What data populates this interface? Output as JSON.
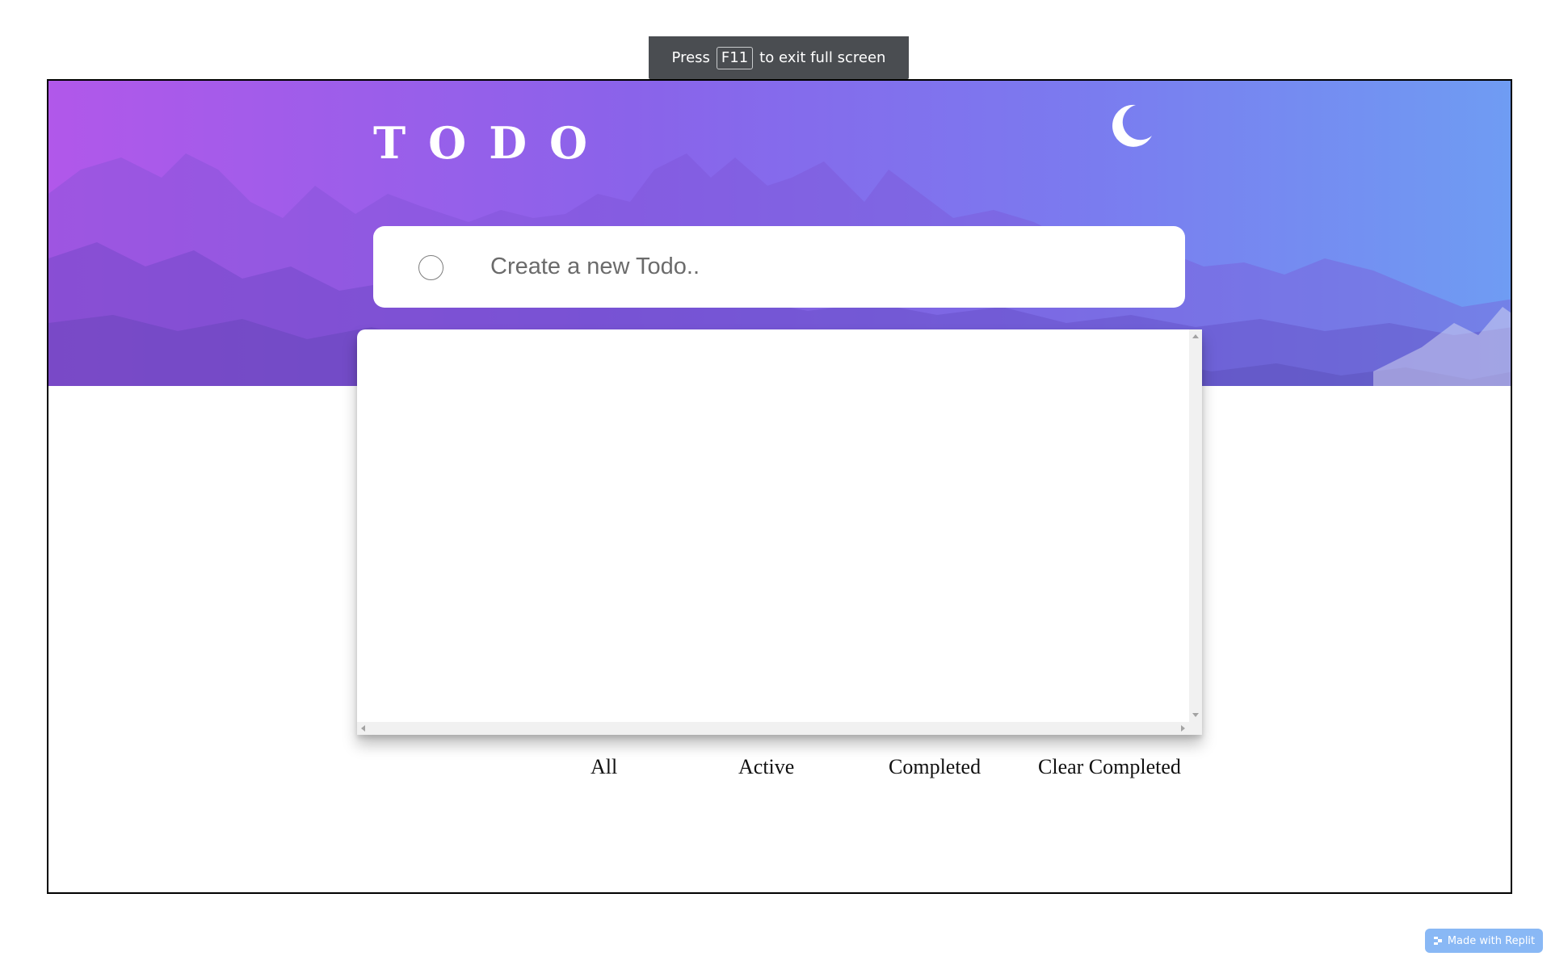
{
  "fullscreen_notice": {
    "prefix": "Press",
    "key": "F11",
    "suffix": "to exit full screen"
  },
  "header": {
    "title": "TODO",
    "theme_toggle_icon": "moon-icon"
  },
  "new_todo": {
    "placeholder": "Create a new Todo..",
    "value": ""
  },
  "todo_list": {
    "items": []
  },
  "filters": {
    "all": "All",
    "active": "Active",
    "completed": "Completed",
    "clear_completed": "Clear Completed"
  },
  "badge": {
    "label": "Made with Replit"
  },
  "colors": {
    "banner_gradient_start": "#b158ea",
    "banner_gradient_end": "#6f9cf3",
    "frame_border": "#000000"
  }
}
